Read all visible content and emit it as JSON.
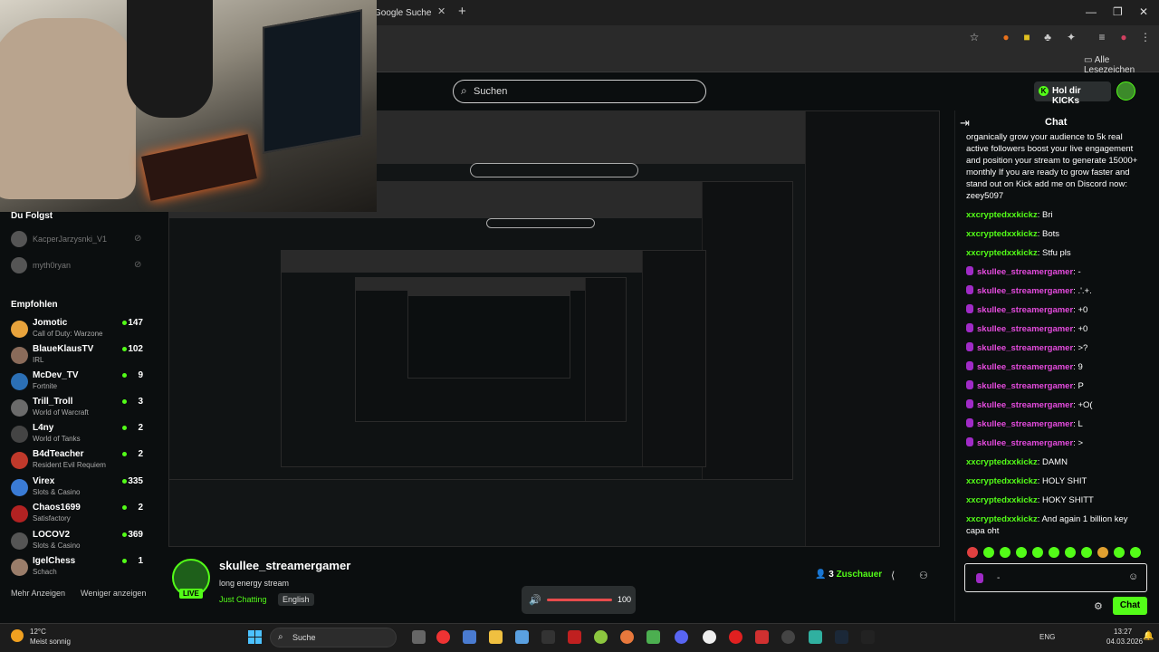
{
  "browser": {
    "tab_title": "Google Suche",
    "bookmarks_label": "Alle Lesezeichen"
  },
  "header": {
    "search_placeholder": "Suchen",
    "cta_label": "Hol dir KICKs"
  },
  "sidebar": {
    "following_heading": "Du Folgst",
    "followed": [
      {
        "name": "KacperJarzysnki_V1"
      },
      {
        "name": "myth0ryan"
      }
    ],
    "recommended_heading": "Empfohlen",
    "channels": [
      {
        "name": "Jomotic",
        "category": "Call of Duty: Warzone",
        "viewers": "147",
        "color": "#e8a33c"
      },
      {
        "name": "BlaueKlausTV",
        "category": "IRL",
        "viewers": "102",
        "color": "#8a6b5a"
      },
      {
        "name": "McDev_TV",
        "category": "Fortnite",
        "viewers": "9",
        "color": "#2b6fb5"
      },
      {
        "name": "Trill_Troll",
        "category": "World of Warcraft",
        "viewers": "3",
        "color": "#6b6b6b"
      },
      {
        "name": "L4ny",
        "category": "World of Tanks",
        "viewers": "2",
        "color": "#444444"
      },
      {
        "name": "B4dTeacher",
        "category": "Resident Evil Requiem",
        "viewers": "2",
        "color": "#c0392b"
      },
      {
        "name": "Virex",
        "category": "Slots & Casino",
        "viewers": "335",
        "color": "#3a7bd5"
      },
      {
        "name": "Chaos1699",
        "category": "Satisfactory",
        "viewers": "2",
        "color": "#b22222"
      },
      {
        "name": "LOCOV2",
        "category": "Slots & Casino",
        "viewers": "369",
        "color": "#555555"
      },
      {
        "name": "IgelChess",
        "category": "Schach",
        "viewers": "1",
        "color": "#9a7d6a"
      }
    ],
    "show_more": "Mehr Anzeigen",
    "show_less": "Weniger anzeigen"
  },
  "stream": {
    "live_label": "LIVE",
    "streamer": "skullee_streamergamer",
    "title": "long energy stream",
    "category": "Just Chatting",
    "language": "English",
    "viewers": "3",
    "viewers_label": "Zuschauer",
    "volume": "100"
  },
  "chat": {
    "title": "Chat",
    "messages": [
      {
        "user": "",
        "text": "organically grow your audience to 5k real active followers boost your live engagement and position your stream to generate 15000+ monthly If you are ready to grow faster and stand out on Kick add me on Discord now: zeey5097",
        "pink": false
      },
      {
        "user": "xxcryptedxxkickz",
        "text": "Bri",
        "pink": false
      },
      {
        "user": "xxcryptedxxkickz",
        "text": "Bots",
        "pink": false
      },
      {
        "user": "xxcryptedxxkickz",
        "text": "Stfu pls",
        "pink": false
      },
      {
        "user": "skullee_streamergamer",
        "text": "-",
        "pink": true
      },
      {
        "user": "skullee_streamergamer",
        "text": ".'.+.",
        "pink": true
      },
      {
        "user": "skullee_streamergamer",
        "text": "+0",
        "pink": true
      },
      {
        "user": "skullee_streamergamer",
        "text": "+0",
        "pink": true
      },
      {
        "user": "skullee_streamergamer",
        "text": ">?",
        "pink": true
      },
      {
        "user": "skullee_streamergamer",
        "text": "9",
        "pink": true
      },
      {
        "user": "skullee_streamergamer",
        "text": "P",
        "pink": true
      },
      {
        "user": "skullee_streamergamer",
        "text": "+O(",
        "pink": true
      },
      {
        "user": "skullee_streamergamer",
        "text": "L",
        "pink": true
      },
      {
        "user": "skullee_streamergamer",
        "text": ">",
        "pink": true
      },
      {
        "user": "xxcryptedxxkickz",
        "text": "DAMN",
        "pink": false
      },
      {
        "user": "xxcryptedxxkickz",
        "text": "HOLY SHIT",
        "pink": false
      },
      {
        "user": "xxcryptedxxkickz",
        "text": "HOKY SHITT",
        "pink": false
      },
      {
        "user": "xxcryptedxxkickz",
        "text": "And again 1 billion key capa oht",
        "pink": false
      }
    ],
    "input_value": "-",
    "send_label": "Chat"
  },
  "taskbar": {
    "temperature": "12°C",
    "weather": "Meist sonnig",
    "search_label": "Suche",
    "language": "ENG",
    "time": "13:27",
    "date": "04.03.2026"
  }
}
